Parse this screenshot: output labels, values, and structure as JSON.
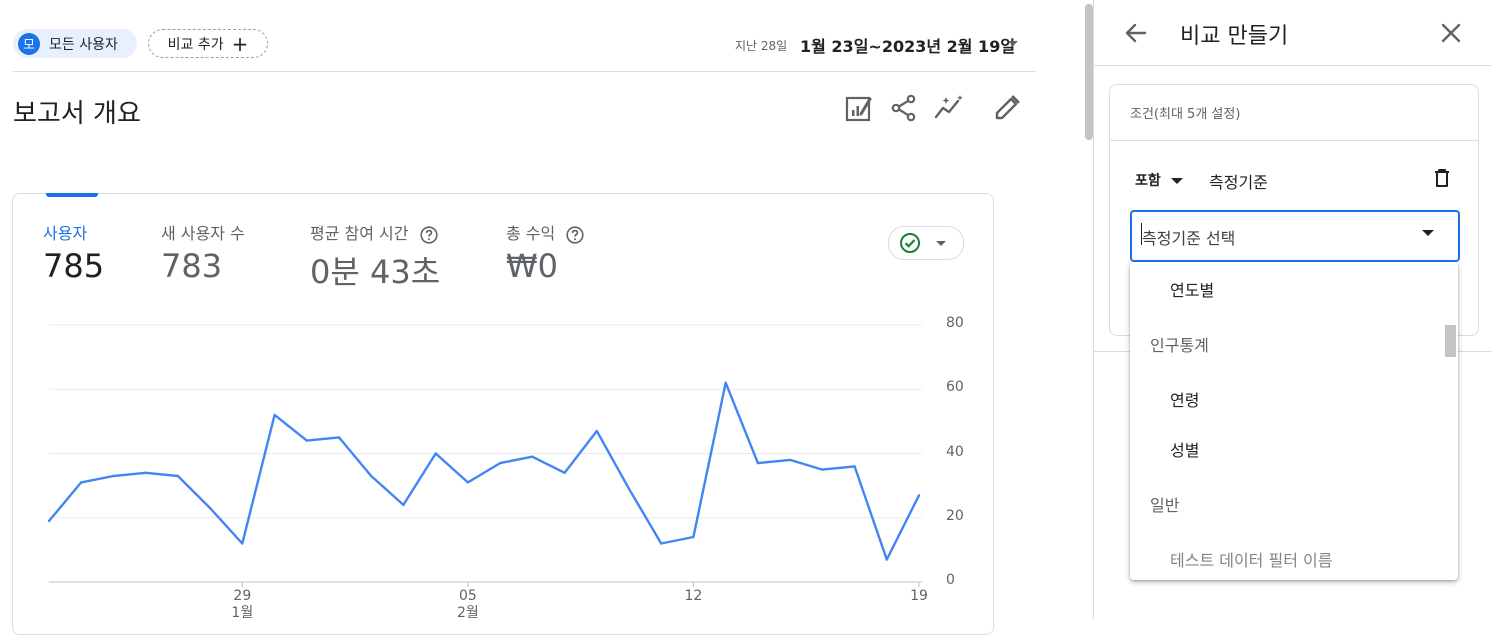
{
  "header": {
    "segment_chip": {
      "avatar_letter": "모",
      "label": "모든 사용자"
    },
    "add_compare_label": "비교 추가",
    "date_prefix": "지난 28일",
    "date_range": "1월 23일~2023년 2월 19일"
  },
  "page_title": "보고서 개요",
  "toolbar": {
    "icons": [
      "customize-report-icon",
      "share-icon",
      "insights-icon",
      "edit-icon"
    ]
  },
  "metrics": [
    {
      "label": "사용자",
      "value": "785",
      "has_help": false,
      "active": true
    },
    {
      "label": "새 사용자 수",
      "value": "783",
      "has_help": false,
      "active": false
    },
    {
      "label": "평균 참여 시간",
      "value": "0분 43초",
      "has_help": true,
      "active": false
    },
    {
      "label": "총 수익",
      "value": "₩0",
      "has_help": true,
      "active": false
    }
  ],
  "colors": {
    "accent": "#1a73e8",
    "line": "#4285f4",
    "check": "#188038"
  },
  "chart_data": {
    "type": "line",
    "series": [
      {
        "values": [
          19,
          31,
          33,
          34,
          33,
          23,
          12,
          52,
          44,
          45,
          33,
          24,
          40,
          31,
          37,
          39,
          34,
          47,
          29,
          12,
          14,
          62,
          37,
          38,
          35,
          36,
          7,
          27
        ]
      }
    ],
    "x_ticks": [
      {
        "label": "29",
        "sub": "1월",
        "index": 6
      },
      {
        "label": "05",
        "sub": "2월",
        "index": 13
      },
      {
        "label": "12",
        "sub": "",
        "index": 20
      },
      {
        "label": "19",
        "sub": "",
        "index": 27
      }
    ],
    "y_ticks": [
      "80",
      "60",
      "40",
      "20",
      "0"
    ],
    "ylim": [
      0,
      80
    ],
    "grid": true,
    "y_axis_side": "right"
  },
  "panel": {
    "title": "비교 만들기",
    "conditions_header": "조건(최대 5개 설정)",
    "include_label": "포함",
    "dimension_label": "측정기준",
    "select_placeholder": "측정기준 선택",
    "dropdown": {
      "item_yearly": "연도별",
      "group_demographics": "인구통계",
      "item_age": "연령",
      "item_gender": "성별",
      "group_general": "일반",
      "item_test_filter": "테스트 데이터 필터 이름"
    }
  }
}
